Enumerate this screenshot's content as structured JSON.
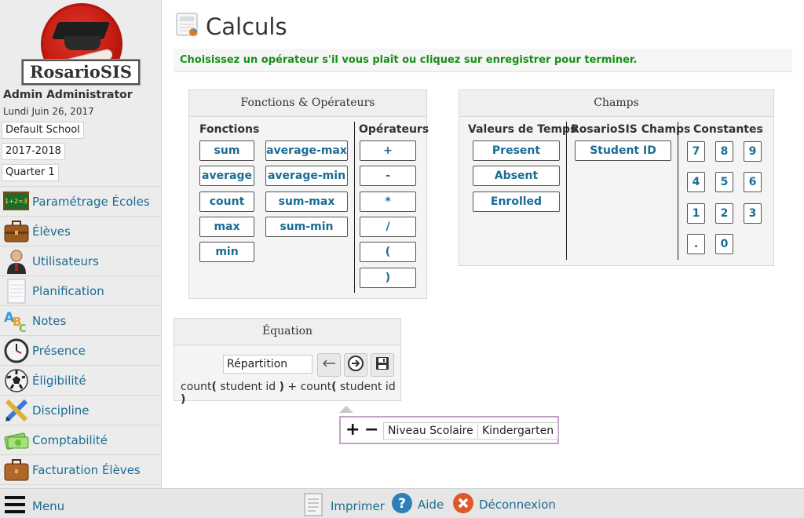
{
  "app": {
    "logo_text": "RosarioSIS"
  },
  "sidebar": {
    "user_name": "Admin Administrator",
    "date": "Lundi Juin 26, 2017",
    "school": "Default School",
    "year": "2017-2018",
    "quarter": "Quarter 1",
    "items": [
      {
        "label": "Paramétrage Écoles",
        "icon": "school-setup-icon"
      },
      {
        "label": "Élèves",
        "icon": "briefcase-icon"
      },
      {
        "label": "Utilisateurs",
        "icon": "user-icon"
      },
      {
        "label": "Planification",
        "icon": "notepad-icon"
      },
      {
        "label": "Notes",
        "icon": "abc-icon"
      },
      {
        "label": "Présence",
        "icon": "clock-icon"
      },
      {
        "label": "Éligibilité",
        "icon": "soccer-ball-icon"
      },
      {
        "label": "Discipline",
        "icon": "pencil-icon"
      },
      {
        "label": "Comptabilité",
        "icon": "money-icon"
      },
      {
        "label": "Facturation Élèves",
        "icon": "billing-icon"
      }
    ]
  },
  "main": {
    "title": "Calculs",
    "message": "Choisissez un opérateur s'il vous plaît ou cliquez sur enregistrer pour terminer."
  },
  "functions_panel": {
    "title": "Fonctions & Opérateurs",
    "functions_header": "Fonctions",
    "operators_header": "Opérateurs",
    "functions_col1": [
      "sum",
      "average",
      "count",
      "max",
      "min"
    ],
    "functions_col2": [
      "average-max",
      "average-min",
      "sum-max",
      "sum-min"
    ],
    "operators": [
      "+",
      "-",
      "*",
      "/",
      "(",
      ")"
    ]
  },
  "champs_panel": {
    "title": "Champs",
    "time_header": "Valeurs de Temps",
    "fields_header": "RosarioSIS Champs",
    "constants_header": "Constantes",
    "time_values": [
      "Present",
      "Absent",
      "Enrolled"
    ],
    "fields": [
      "Student ID"
    ],
    "constants": [
      "7",
      "8",
      "9",
      "4",
      "5",
      "6",
      "1",
      "2",
      "3",
      ".",
      "0"
    ]
  },
  "equation_panel": {
    "title": "Équation",
    "name_value": "Répartition",
    "parts": [
      {
        "text": "count",
        "bold": false
      },
      {
        "text": "(",
        "bold": true
      },
      {
        "text": " student id ",
        "bold": false
      },
      {
        "text": ")",
        "bold": true
      },
      {
        "text": " + count",
        "bold": false
      },
      {
        "text": "(",
        "bold": true
      },
      {
        "text": " student id ",
        "bold": false
      },
      {
        "text": ")",
        "bold": true
      }
    ]
  },
  "filter": {
    "plus": "+",
    "minus": "−",
    "field": "Niveau Scolaire",
    "value": "Kindergarten"
  },
  "footer": {
    "menu_label": "Menu",
    "print_label": "Imprimer",
    "help_label": "Aide",
    "logout_label": "Déconnexion"
  }
}
